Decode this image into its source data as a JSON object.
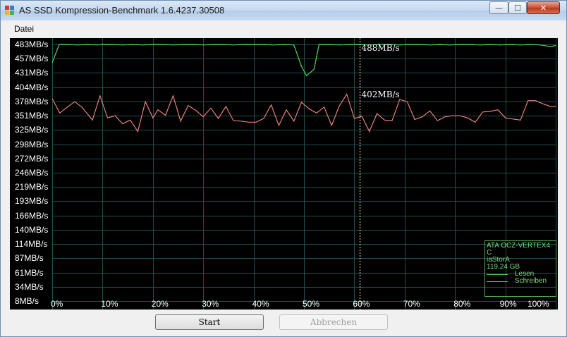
{
  "window": {
    "title": "AS SSD Kompression-Benchmark 1.6.4237.30508"
  },
  "window_buttons": {
    "minimize": "—",
    "maximize": "☐",
    "close": "✕"
  },
  "menu": {
    "items": [
      "Datei"
    ]
  },
  "chart_data": {
    "type": "line",
    "y_ticks": [
      "483MB/s",
      "457MB/s",
      "431MB/s",
      "404MB/s",
      "378MB/s",
      "351MB/s",
      "325MB/s",
      "298MB/s",
      "272MB/s",
      "246MB/s",
      "219MB/s",
      "193MB/s",
      "166MB/s",
      "140MB/s",
      "114MB/s",
      "87MB/s",
      "61MB/s",
      "34MB/s",
      "8MB/s"
    ],
    "x_ticks": [
      "0%",
      "10%",
      "20%",
      "30%",
      "40%",
      "50%",
      "60%",
      "70%",
      "80%",
      "90%",
      "100%"
    ],
    "ylim": [
      8,
      483
    ],
    "xlim": [
      0,
      100
    ],
    "marker": {
      "x": 61,
      "read_label": "488MB/s",
      "write_label": "402MB/s"
    },
    "series": [
      {
        "name": "Lesen",
        "color": "#5bd35b",
        "x": [
          0,
          1.4,
          3,
          5,
          7,
          9,
          10,
          12,
          14,
          16,
          18,
          20,
          22,
          24,
          26,
          28,
          30,
          32,
          34,
          36,
          38,
          40,
          42,
          44,
          46,
          48,
          49.5,
          50.5,
          52,
          53,
          55,
          57,
          59,
          61,
          63,
          65,
          67,
          69,
          71,
          73,
          75,
          77,
          79,
          81,
          83,
          85,
          87,
          89,
          91,
          93,
          95,
          97,
          99,
          100
        ],
        "values": [
          449,
          483,
          483,
          482,
          483,
          482,
          483,
          483,
          482,
          483,
          482,
          483,
          483,
          482,
          483,
          483,
          482,
          483,
          483,
          482,
          483,
          483,
          483,
          482,
          483,
          482,
          443,
          425,
          437,
          483,
          483,
          482,
          483,
          483,
          482,
          483,
          483,
          482,
          483,
          483,
          482,
          483,
          482,
          483,
          483,
          482,
          483,
          482,
          483,
          482,
          483,
          482,
          479,
          481
        ]
      },
      {
        "name": "Schreiben",
        "color": "#e87f7f",
        "x": [
          0,
          1.5,
          3,
          4.5,
          6,
          8,
          9.5,
          11,
          12.5,
          14,
          15.5,
          17,
          18.5,
          20,
          21,
          22.5,
          24,
          25.5,
          27,
          28.5,
          30,
          31.5,
          33,
          34.5,
          36,
          37.5,
          39,
          40.5,
          42,
          43.5,
          45,
          46.5,
          48,
          49.5,
          51,
          52.5,
          54,
          55.5,
          57,
          58.5,
          60,
          61.5,
          63,
          64.5,
          66,
          67.5,
          69,
          70.5,
          72,
          73.5,
          75,
          76.5,
          78,
          79.5,
          81,
          82.5,
          84,
          85.5,
          87,
          88.5,
          90,
          91.5,
          93,
          94.5,
          96,
          97.5,
          99,
          100
        ],
        "values": [
          383,
          356,
          367,
          377,
          366,
          343,
          388,
          347,
          351,
          336,
          343,
          322,
          377,
          347,
          362,
          352,
          388,
          341,
          370,
          361,
          349,
          365,
          346,
          368,
          342,
          341,
          339,
          339,
          346,
          371,
          333,
          362,
          341,
          376,
          364,
          356,
          367,
          333,
          369,
          391,
          346,
          350,
          322,
          355,
          343,
          342,
          381,
          377,
          344,
          349,
          360,
          342,
          349,
          351,
          351,
          347,
          339,
          358,
          359,
          362,
          347,
          345,
          343,
          379,
          379,
          373,
          368,
          368
        ]
      }
    ]
  },
  "legend": {
    "device": "ATA OCZ-VERTEX4",
    "partition": "C",
    "driver": "iaStorA",
    "size": "119.24 GB",
    "entries": [
      {
        "label": "Lesen",
        "color": "#5bd35b"
      },
      {
        "label": "Schreiben",
        "color": "#e87f7f"
      }
    ]
  },
  "buttons": {
    "start": "Start",
    "cancel": "Abbrechen"
  }
}
